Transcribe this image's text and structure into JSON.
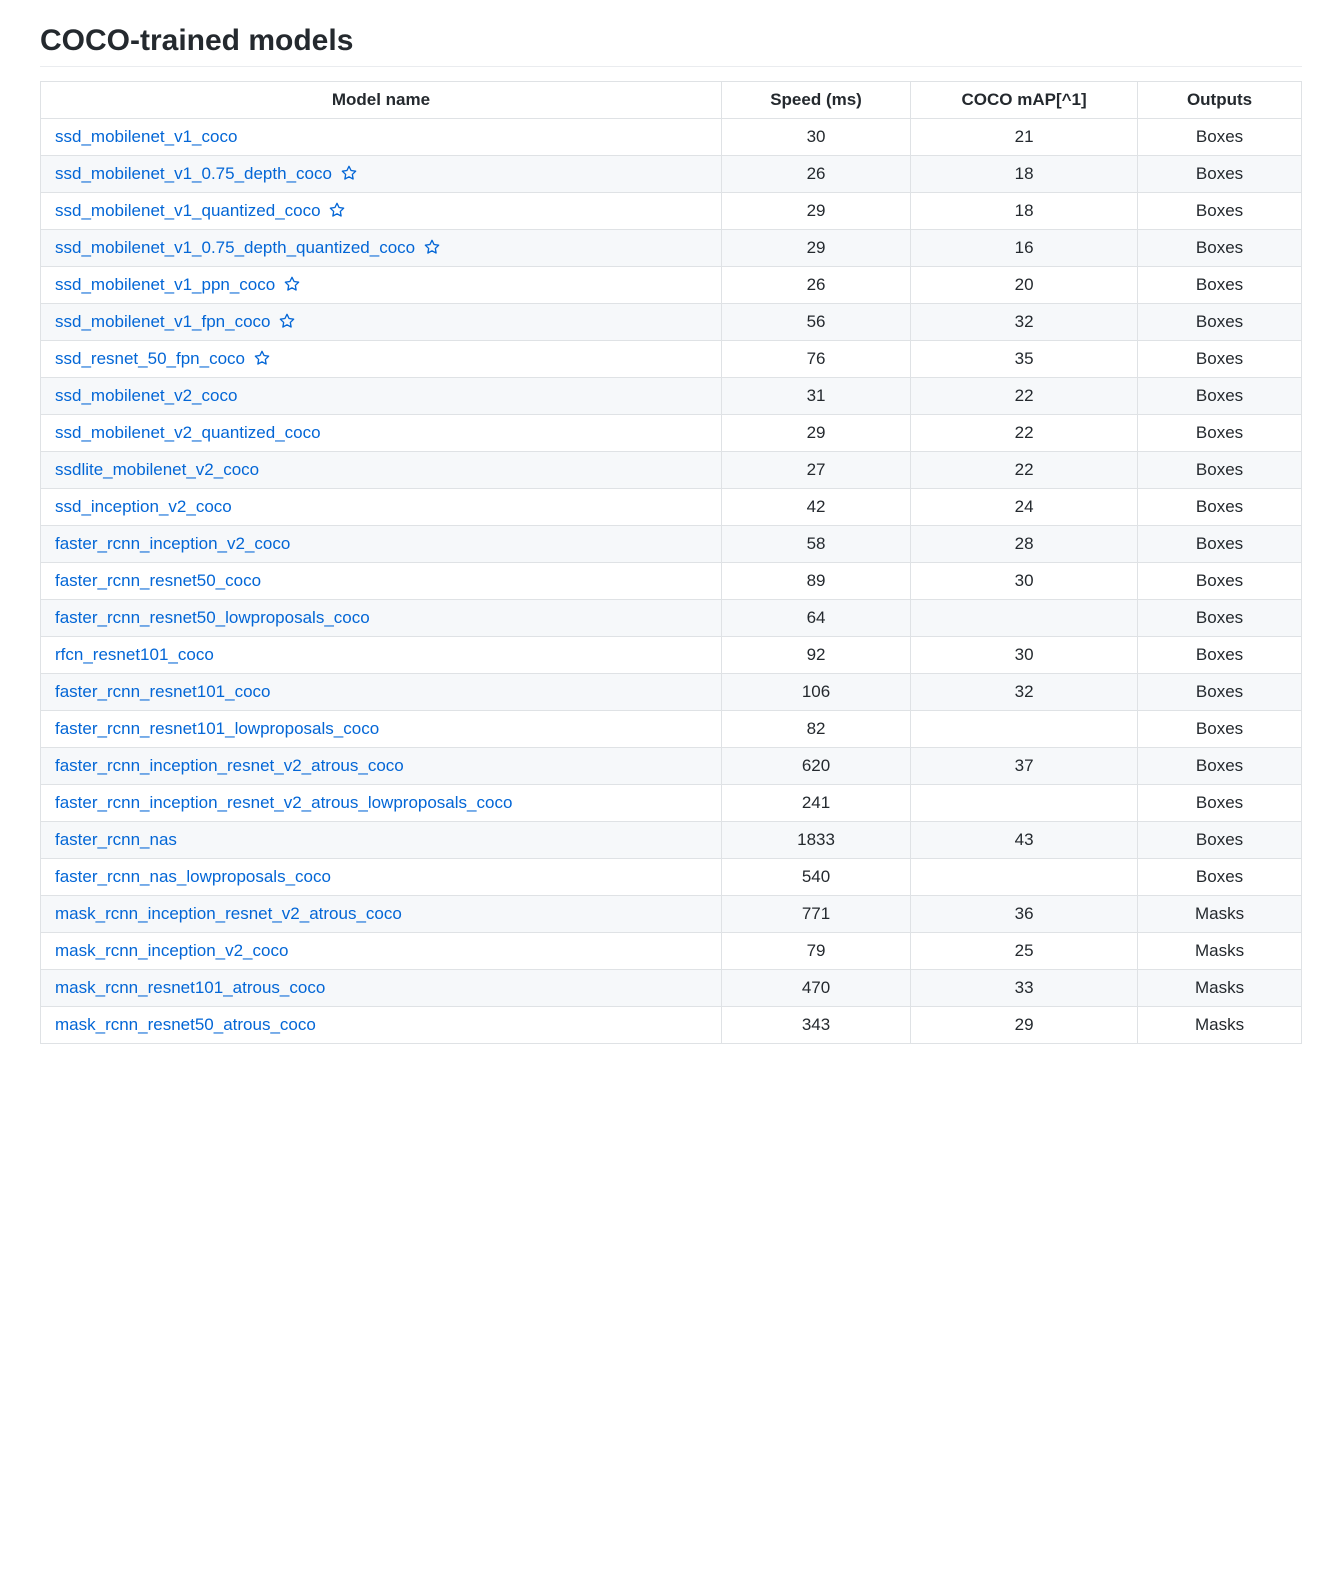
{
  "heading": "COCO-trained models",
  "columns": [
    "Model name",
    "Speed (ms)",
    "COCO mAP[^1]",
    "Outputs"
  ],
  "rows": [
    {
      "name": "ssd_mobilenet_v1_coco",
      "star": false,
      "speed": "30",
      "map": "21",
      "outputs": "Boxes"
    },
    {
      "name": "ssd_mobilenet_v1_0.75_depth_coco",
      "star": true,
      "speed": "26",
      "map": "18",
      "outputs": "Boxes"
    },
    {
      "name": "ssd_mobilenet_v1_quantized_coco",
      "star": true,
      "speed": "29",
      "map": "18",
      "outputs": "Boxes"
    },
    {
      "name": "ssd_mobilenet_v1_0.75_depth_quantized_coco",
      "star": true,
      "speed": "29",
      "map": "16",
      "outputs": "Boxes"
    },
    {
      "name": "ssd_mobilenet_v1_ppn_coco",
      "star": true,
      "speed": "26",
      "map": "20",
      "outputs": "Boxes"
    },
    {
      "name": "ssd_mobilenet_v1_fpn_coco",
      "star": true,
      "speed": "56",
      "map": "32",
      "outputs": "Boxes"
    },
    {
      "name": "ssd_resnet_50_fpn_coco",
      "star": true,
      "speed": "76",
      "map": "35",
      "outputs": "Boxes"
    },
    {
      "name": "ssd_mobilenet_v2_coco",
      "star": false,
      "speed": "31",
      "map": "22",
      "outputs": "Boxes"
    },
    {
      "name": "ssd_mobilenet_v2_quantized_coco",
      "star": false,
      "speed": "29",
      "map": "22",
      "outputs": "Boxes"
    },
    {
      "name": "ssdlite_mobilenet_v2_coco",
      "star": false,
      "speed": "27",
      "map": "22",
      "outputs": "Boxes"
    },
    {
      "name": "ssd_inception_v2_coco",
      "star": false,
      "speed": "42",
      "map": "24",
      "outputs": "Boxes"
    },
    {
      "name": "faster_rcnn_inception_v2_coco",
      "star": false,
      "speed": "58",
      "map": "28",
      "outputs": "Boxes"
    },
    {
      "name": "faster_rcnn_resnet50_coco",
      "star": false,
      "speed": "89",
      "map": "30",
      "outputs": "Boxes"
    },
    {
      "name": "faster_rcnn_resnet50_lowproposals_coco",
      "star": false,
      "speed": "64",
      "map": "",
      "outputs": "Boxes"
    },
    {
      "name": "rfcn_resnet101_coco",
      "star": false,
      "speed": "92",
      "map": "30",
      "outputs": "Boxes"
    },
    {
      "name": "faster_rcnn_resnet101_coco",
      "star": false,
      "speed": "106",
      "map": "32",
      "outputs": "Boxes"
    },
    {
      "name": "faster_rcnn_resnet101_lowproposals_coco",
      "star": false,
      "speed": "82",
      "map": "",
      "outputs": "Boxes"
    },
    {
      "name": "faster_rcnn_inception_resnet_v2_atrous_coco",
      "star": false,
      "speed": "620",
      "map": "37",
      "outputs": "Boxes"
    },
    {
      "name": "faster_rcnn_inception_resnet_v2_atrous_lowproposals_coco",
      "star": false,
      "speed": "241",
      "map": "",
      "outputs": "Boxes"
    },
    {
      "name": "faster_rcnn_nas",
      "star": false,
      "speed": "1833",
      "map": "43",
      "outputs": "Boxes"
    },
    {
      "name": "faster_rcnn_nas_lowproposals_coco",
      "star": false,
      "speed": "540",
      "map": "",
      "outputs": "Boxes"
    },
    {
      "name": "mask_rcnn_inception_resnet_v2_atrous_coco",
      "star": false,
      "speed": "771",
      "map": "36",
      "outputs": "Masks"
    },
    {
      "name": "mask_rcnn_inception_v2_coco",
      "star": false,
      "speed": "79",
      "map": "25",
      "outputs": "Masks"
    },
    {
      "name": "mask_rcnn_resnet101_atrous_coco",
      "star": false,
      "speed": "470",
      "map": "33",
      "outputs": "Masks"
    },
    {
      "name": "mask_rcnn_resnet50_atrous_coco",
      "star": false,
      "speed": "343",
      "map": "29",
      "outputs": "Masks"
    }
  ]
}
